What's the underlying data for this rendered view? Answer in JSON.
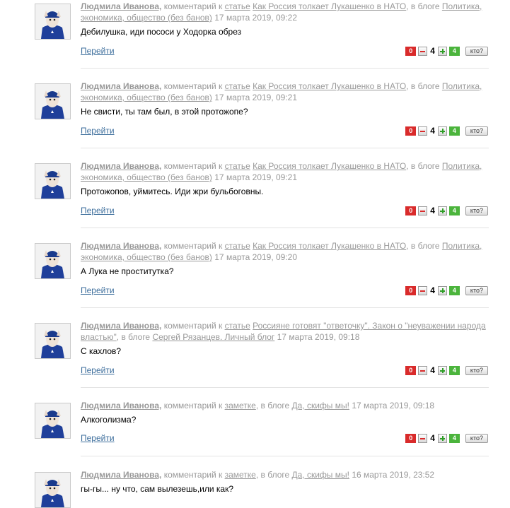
{
  "labels": {
    "go": "Перейти",
    "who": "кто?"
  },
  "comments": [
    {
      "author": "Людмила Иванова,",
      "pre_link": "комментарий к ",
      "target_type": "статье",
      "sep1": " ",
      "title": "Как Россия толкает Лукашенко в НАТО",
      "blog_prefix": ", в блоге ",
      "blog": "Политика, экономика, общество (без банов)",
      "date": " 17 марта 2019, 09:22",
      "text": "Дебилушка, иди пососи у Ходорка обрез",
      "votes": {
        "down": "0",
        "score": "4",
        "up": "4"
      }
    },
    {
      "author": "Людмила Иванова,",
      "pre_link": "комментарий к ",
      "target_type": "статье",
      "sep1": " ",
      "title": "Как Россия толкает Лукашенко в НАТО",
      "blog_prefix": ", в блоге ",
      "blog": "Политика, экономика, общество (без банов)",
      "date": " 17 марта 2019, 09:21",
      "text": "Не свисти, ты там был, в этой протожопе?",
      "votes": {
        "down": "0",
        "score": "4",
        "up": "4"
      }
    },
    {
      "author": "Людмила Иванова,",
      "pre_link": "комментарий к ",
      "target_type": "статье",
      "sep1": " ",
      "title": "Как Россия толкает Лукашенко в НАТО",
      "blog_prefix": ", в блоге ",
      "blog": "Политика, экономика, общество (без банов)",
      "date": " 17 марта 2019, 09:21",
      "text": "Протожопов, уймитесь. Иди жри бульбоговны.",
      "votes": {
        "down": "0",
        "score": "4",
        "up": "4"
      }
    },
    {
      "author": "Людмила Иванова,",
      "pre_link": "комментарий к ",
      "target_type": "статье",
      "sep1": " ",
      "title": "Как Россия толкает Лукашенко в НАТО",
      "blog_prefix": ", в блоге ",
      "blog": "Политика, экономика, общество (без банов)",
      "date": " 17 марта 2019, 09:20",
      "text": "А Лука не проститутка?",
      "votes": {
        "down": "0",
        "score": "4",
        "up": "4"
      }
    },
    {
      "author": "Людмила Иванова,",
      "pre_link": "комментарий к ",
      "target_type": "статье",
      "sep1": " ",
      "title": "Россияне готовят \"ответочку\". Закон о \"неуважении народа властью\"",
      "blog_prefix": ", в блоге ",
      "blog": "Сергей Рязанцев. Личный блог",
      "date": " 17 марта 2019, 09:18",
      "text": "С кахлов?",
      "votes": {
        "down": "0",
        "score": "4",
        "up": "4"
      }
    },
    {
      "author": "Людмила Иванова,",
      "pre_link": "комментарий к ",
      "target_type": "заметке",
      "sep1": " ",
      "title": "",
      "blog_prefix": ", в блоге ",
      "blog": "Да, скифы мы!",
      "date": " 17 марта 2019, 09:18",
      "text": "Алкоголизма?",
      "votes": {
        "down": "0",
        "score": "4",
        "up": "4"
      }
    },
    {
      "author": "Людмила Иванова,",
      "pre_link": "комментарий к ",
      "target_type": "заметке",
      "sep1": " ",
      "title": "",
      "blog_prefix": ", в блоге ",
      "blog": "Да, скифы мы!",
      "date": " 16 марта 2019, 23:52",
      "text": "гы-гы... ну что, сам вылезешь,или как?",
      "votes": {
        "down": "",
        "score": "",
        "up": ""
      }
    }
  ]
}
